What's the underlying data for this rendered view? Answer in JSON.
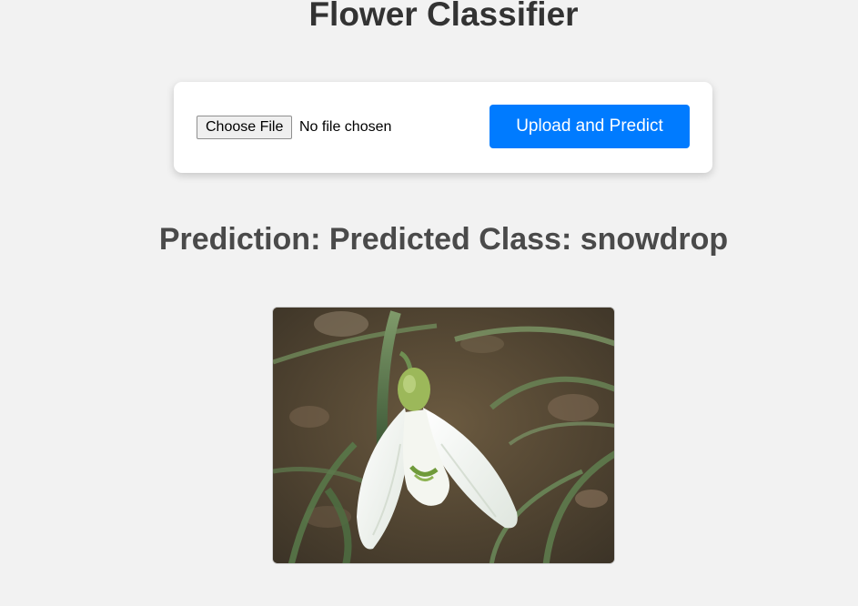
{
  "page": {
    "title": "Flower Classifier"
  },
  "upload_form": {
    "file_button_label": "Choose File",
    "file_status": "No file chosen",
    "submit_label": "Upload and Predict"
  },
  "result": {
    "prediction_text": "Prediction: Predicted Class: snowdrop",
    "image_subject": "snowdrop flower photo"
  },
  "colors": {
    "background": "#f2f2f2",
    "accent": "#007bff",
    "title": "#333333",
    "prediction": "#4a4a4a"
  }
}
